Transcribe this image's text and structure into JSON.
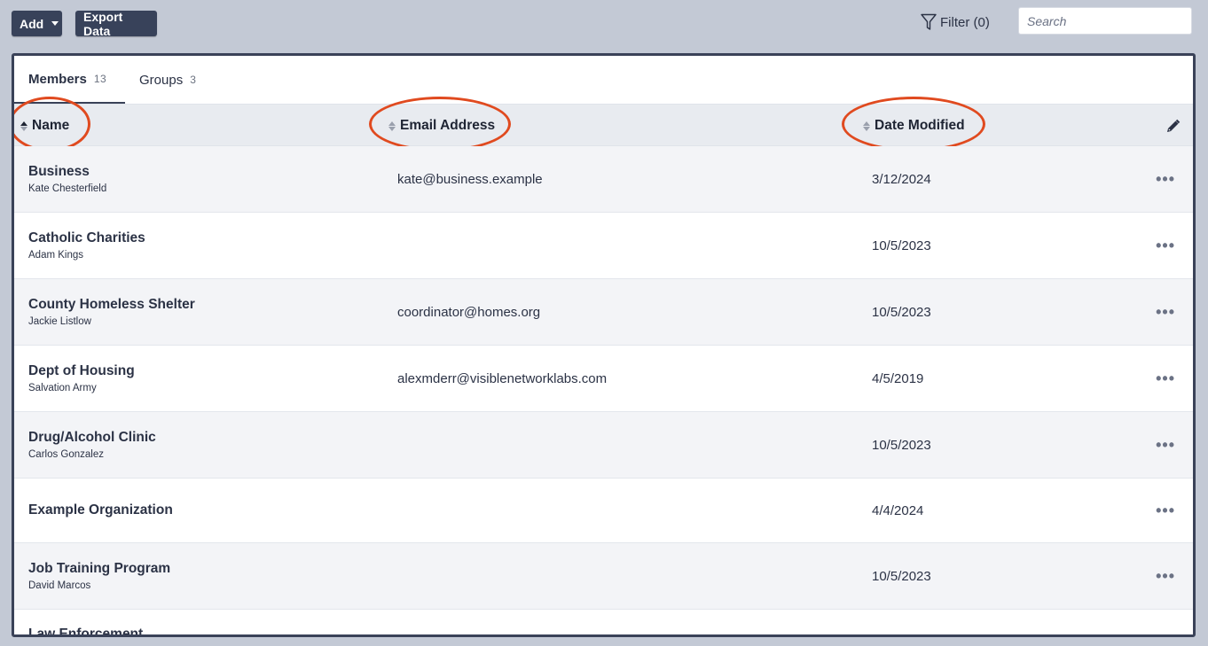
{
  "toolbar": {
    "add_label": "Add",
    "export_label": "Export Data",
    "filter_label": "Filter (0)",
    "search_placeholder": "Search"
  },
  "tabs": [
    {
      "label": "Members",
      "count": "13"
    },
    {
      "label": "Groups",
      "count": "3"
    }
  ],
  "columns": {
    "name": "Name",
    "email": "Email Address",
    "date": "Date Modified"
  },
  "rows": [
    {
      "name": "Business",
      "contact": "Kate Chesterfield",
      "email": "kate@business.example",
      "date": "3/12/2024"
    },
    {
      "name": "Catholic Charities",
      "contact": "Adam Kings",
      "email": "",
      "date": "10/5/2023"
    },
    {
      "name": "County Homeless Shelter",
      "contact": "Jackie Listlow",
      "email": "coordinator@homes.org",
      "date": "10/5/2023"
    },
    {
      "name": "Dept of Housing",
      "contact": "Salvation Army",
      "email": "alexmderr@visiblenetworklabs.com",
      "date": "4/5/2019"
    },
    {
      "name": "Drug/Alcohol Clinic",
      "contact": "Carlos Gonzalez",
      "email": "",
      "date": "10/5/2023"
    },
    {
      "name": "Example Organization",
      "contact": "",
      "email": "",
      "date": "4/4/2024"
    },
    {
      "name": "Job Training Program",
      "contact": "David Marcos",
      "email": "",
      "date": "10/5/2023"
    },
    {
      "name": "Law Enforcement",
      "contact": "",
      "email": "",
      "date": ""
    }
  ],
  "more_glyph": "•••",
  "colors": {
    "accent": "#38425a",
    "highlight": "#e04a1f",
    "background": "#c3c9d5"
  }
}
